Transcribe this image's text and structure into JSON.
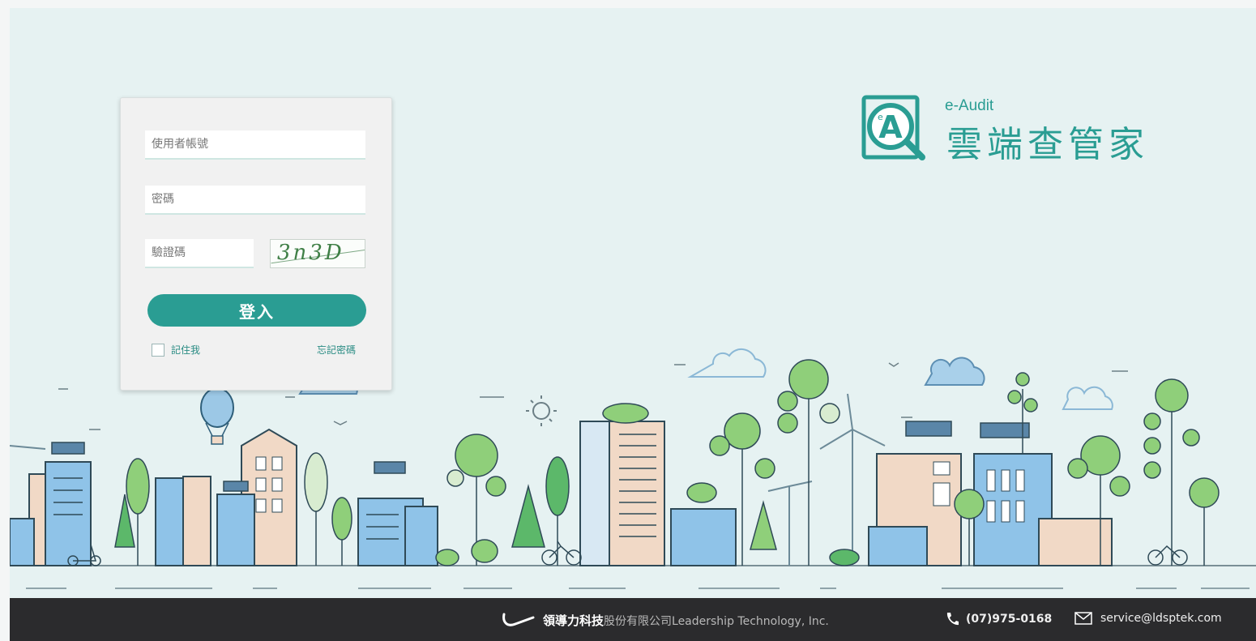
{
  "login": {
    "username_placeholder": "使用者帳號",
    "password_placeholder": "密碼",
    "captcha_placeholder": "驗證碼",
    "captcha_text": "3n3D",
    "submit_label": "登入",
    "remember_label": "記住我",
    "forgot_label": "忘記密碼"
  },
  "brand": {
    "tag": "e-Audit",
    "title": "雲端查管家",
    "logo_icon": "magnifier-a-icon",
    "accent": "#2a9d93"
  },
  "footer": {
    "company_name": "領導力科技",
    "company_rest": "股份有限公司Leadership Technology, Inc.",
    "phone": "(07)975-0168",
    "email": "service@ldsptek.com",
    "background": "#2b2b2d"
  }
}
